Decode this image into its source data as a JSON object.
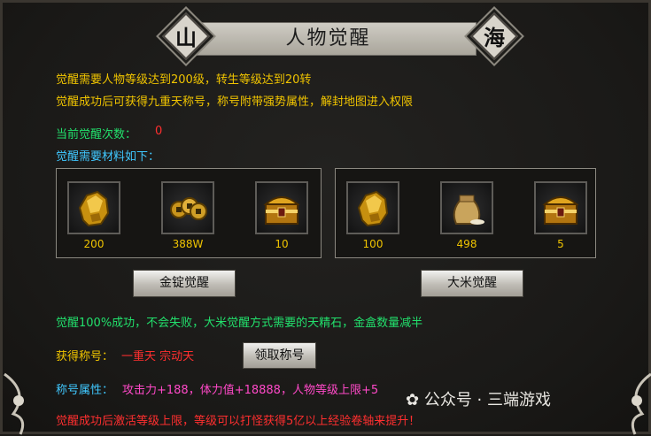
{
  "title": "人物觉醒",
  "badges": {
    "left": "山",
    "right": "海"
  },
  "info": {
    "line1": "觉醒需要人物等级达到200级，转生等级达到20转",
    "line2": "觉醒成功后可获得九重天称号，称号附带强势属性，解封地图进入权限"
  },
  "awaken_count": {
    "label": "当前觉醒次数：",
    "value": "0"
  },
  "materials_label": "觉醒需要材料如下：",
  "left_panel": {
    "items": [
      {
        "icon": "gold-ore-icon",
        "qty": "200"
      },
      {
        "icon": "coins-icon",
        "qty": "388W"
      },
      {
        "icon": "treasure-chest-icon",
        "qty": "10"
      }
    ],
    "button": "金锭觉醒"
  },
  "right_panel": {
    "items": [
      {
        "icon": "gold-ore-icon",
        "qty": "100"
      },
      {
        "icon": "rice-sack-icon",
        "qty": "498"
      },
      {
        "icon": "treasure-chest-icon",
        "qty": "5"
      }
    ],
    "button": "大米觉醒"
  },
  "note": "觉醒100%成功，不会失败，大米觉醒方式需要的天精石，金盒数量减半",
  "title_reward": {
    "label": "获得称号：",
    "value": "一重天 宗动天",
    "button": "领取称号"
  },
  "title_attr": {
    "label": "称号属性：",
    "value": "攻击力+188，体力值+18888，人物等级上限+5"
  },
  "footer": "觉醒成功后激活等级上限，等级可以打怪获得5亿以上经验卷轴来提升！",
  "watermark": "公众号 · 三端游戏",
  "colors": {
    "yellow": "#f0c400",
    "green": "#22e06c",
    "cyan": "#40c8ff",
    "red": "#ff2f2f",
    "pink": "#ff49c8"
  }
}
